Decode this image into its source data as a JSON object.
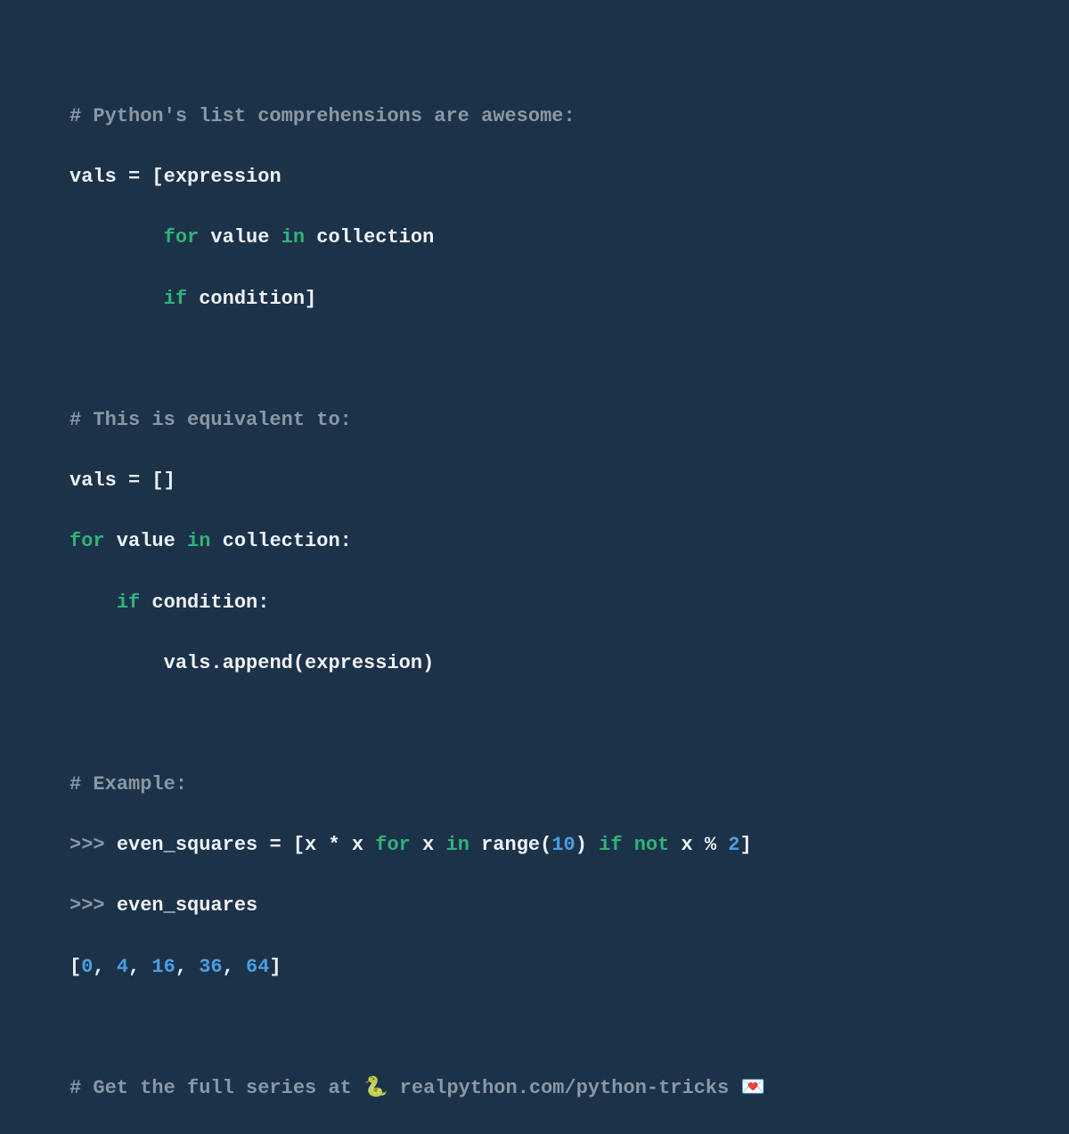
{
  "comments": {
    "c1": "# Python's list comprehensions are awesome:",
    "c2": "# This is equivalent to:",
    "c3": "# Example:",
    "c4a": "# Get the full series at ",
    "c4_snake": "🐍",
    "c4b": " realpython.com/python-tricks ",
    "c4_heart": "💌"
  },
  "block1": {
    "l1a": "vals ",
    "l1b": "=",
    "l1c": " [expression",
    "l2_pad": "        ",
    "l2_for": "for",
    "l2_mid": " value ",
    "l2_in": "in",
    "l2_end": " collection",
    "l3_pad": "        ",
    "l3_if": "if",
    "l3_end": " condition]"
  },
  "block2": {
    "l1a": "vals ",
    "l1b": "=",
    "l1c": " []",
    "l2_for": "for",
    "l2_mid": " value ",
    "l2_in": "in",
    "l2_end": " collection:",
    "l3_pad": "    ",
    "l3_if": "if",
    "l3_end": " condition:",
    "l4_pad": "        ",
    "l4_end": "vals.append(expression)"
  },
  "block3": {
    "prompt": ">>> ",
    "l1a": "even_squares ",
    "l1eq": "=",
    "l1b": " [x ",
    "l1star": "*",
    "l1c": " x ",
    "l1_for": "for",
    "l1d": " x ",
    "l1_in": "in",
    "l1e": " range(",
    "l1_ten": "10",
    "l1f": ") ",
    "l1_if": "if",
    "l1g": " ",
    "l1_not": "not",
    "l1h": " x ",
    "l1_mod": "%",
    "l1i": " ",
    "l1_two": "2",
    "l1j": "]",
    "l2a": "even_squares",
    "l3_open": "[",
    "l3_v0": "0",
    "l3_c1": ", ",
    "l3_v1": "4",
    "l3_c2": ", ",
    "l3_v2": "16",
    "l3_c3": ", ",
    "l3_v3": "36",
    "l3_c4": ", ",
    "l3_v4": "64",
    "l3_close": "]"
  }
}
